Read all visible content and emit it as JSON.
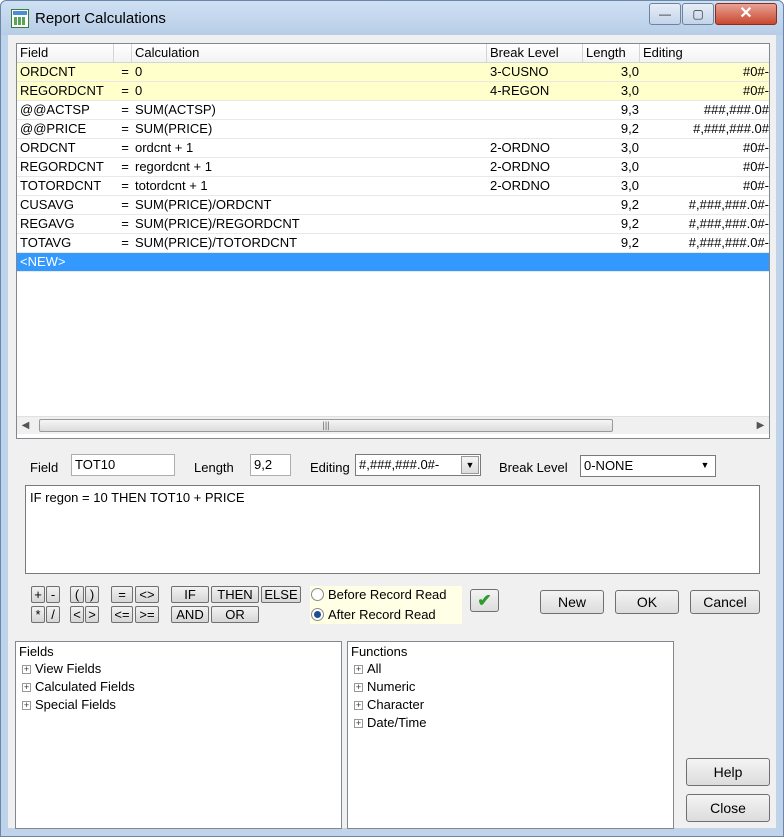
{
  "window": {
    "title": "Report Calculations",
    "min_glyph": "—",
    "max_glyph": "▢",
    "close_glyph": "✕"
  },
  "grid": {
    "columns": [
      "Field",
      "",
      "Calculation",
      "Break Level",
      "Length",
      "Editing"
    ],
    "rows": [
      {
        "field": "ORDCNT",
        "eq": "=",
        "calc": "0",
        "brk": "3-CUSNO",
        "len": "3,0",
        "edit": "#0#-",
        "highlight": "yellow"
      },
      {
        "field": "REGORDCNT",
        "eq": "=",
        "calc": "0",
        "brk": "4-REGON",
        "len": "3,0",
        "edit": "#0#-",
        "highlight": "yellow"
      },
      {
        "field": "@@ACTSP",
        "eq": "=",
        "calc": "SUM(ACTSP)",
        "brk": "",
        "len": "9,3",
        "edit": "###,###.0#",
        "highlight": ""
      },
      {
        "field": "@@PRICE",
        "eq": "=",
        "calc": "SUM(PRICE)",
        "brk": "",
        "len": "9,2",
        "edit": "#,###,###.0#",
        "highlight": ""
      },
      {
        "field": "ORDCNT",
        "eq": "=",
        "calc": "ordcnt + 1",
        "brk": "2-ORDNO",
        "len": "3,0",
        "edit": "#0#-",
        "highlight": ""
      },
      {
        "field": "REGORDCNT",
        "eq": "=",
        "calc": "regordcnt + 1",
        "brk": "2-ORDNO",
        "len": "3,0",
        "edit": "#0#-",
        "highlight": ""
      },
      {
        "field": "TOTORDCNT",
        "eq": "=",
        "calc": "totordcnt + 1",
        "brk": "2-ORDNO",
        "len": "3,0",
        "edit": "#0#-",
        "highlight": ""
      },
      {
        "field": "CUSAVG",
        "eq": "=",
        "calc": "SUM(PRICE)/ORDCNT",
        "brk": "",
        "len": "9,2",
        "edit": "#,###,###.0#-",
        "highlight": ""
      },
      {
        "field": "REGAVG",
        "eq": "=",
        "calc": "SUM(PRICE)/REGORDCNT",
        "brk": "",
        "len": "9,2",
        "edit": "#,###,###.0#-",
        "highlight": ""
      },
      {
        "field": "TOTAVG",
        "eq": "=",
        "calc": "SUM(PRICE)/TOTORDCNT",
        "brk": "",
        "len": "9,2",
        "edit": "#,###,###.0#-",
        "highlight": ""
      },
      {
        "field": "<NEW>",
        "eq": "",
        "calc": "",
        "brk": "",
        "len": "",
        "edit": "",
        "highlight": "selected"
      }
    ],
    "scroll_left": "◀",
    "scroll_right": "▶",
    "scroll_grip": "|||"
  },
  "editor": {
    "field_label": "Field",
    "field_value": "TOT10",
    "length_label": "Length",
    "length_value": "9,2",
    "editing_label": "Editing",
    "editing_value": "#,###,###.0#-",
    "break_label": "Break Level",
    "break_value": "0-NONE",
    "dropdown_glyph": "▼",
    "expression": "IF regon = 10 THEN TOT10 + PRICE"
  },
  "keypad": {
    "plus": "+",
    "minus": "-",
    "lparen": "(",
    "rparen": ")",
    "eq": "=",
    "ne": "<>",
    "if": "IF",
    "then": "THEN",
    "else": "ELSE",
    "mul": "*",
    "div": "/",
    "lt": "<",
    "gt": ">",
    "le": "<=",
    "ge": ">=",
    "and": "AND",
    "or": "OR"
  },
  "timing": {
    "before": "Before Record Read",
    "after": "After Record Read",
    "selected": "after"
  },
  "check_glyph": "✔",
  "buttons": {
    "new": "New",
    "ok": "OK",
    "cancel": "Cancel",
    "help": "Help",
    "close": "Close"
  },
  "fields_panel": {
    "title": "Fields",
    "items": [
      "View Fields",
      "Calculated Fields",
      "Special Fields"
    ]
  },
  "functions_panel": {
    "title": "Functions",
    "items": [
      "All",
      "Numeric",
      "Character",
      "Date/Time"
    ]
  },
  "expander_glyph": "+",
  "colors": {
    "highlight_yellow": "#ffffcc",
    "selection": "#3399ff",
    "check_green": "#2a9d2a"
  }
}
